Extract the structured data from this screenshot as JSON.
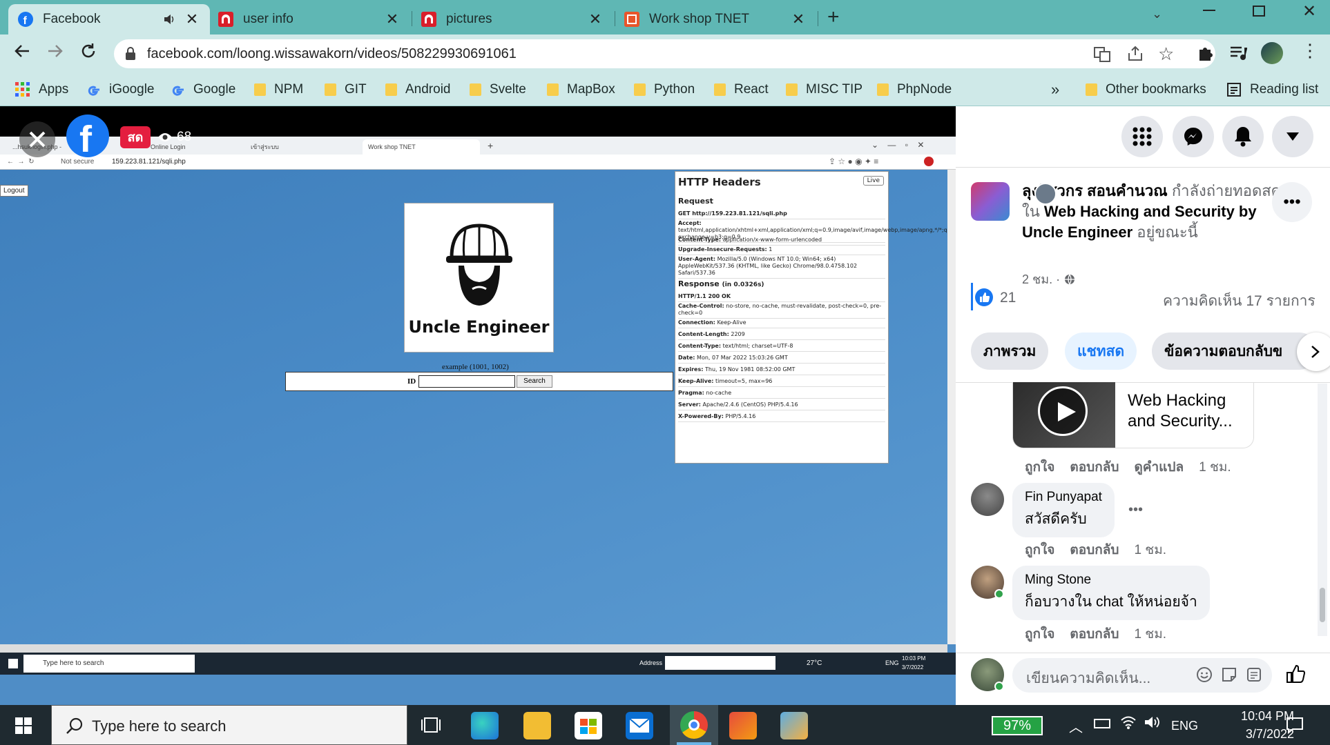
{
  "browser": {
    "tabs": [
      {
        "title": "Facebook",
        "icon": "facebook-icon",
        "active": true
      },
      {
        "title": "user info",
        "icon": "red-app-icon"
      },
      {
        "title": "pictures",
        "icon": "red-app-icon"
      },
      {
        "title": "Work shop TNET",
        "icon": "orange-app-icon"
      }
    ],
    "new_tab_label": "+",
    "url": "facebook.com/loong.wissawakorn/videos/508229930691061",
    "bookmarks": [
      {
        "label": "Apps",
        "icon": "apps-grid-icon"
      },
      {
        "label": "iGoogle",
        "icon": "google-icon"
      },
      {
        "label": "Google",
        "icon": "google-icon"
      },
      {
        "label": "NPM",
        "icon": "folder-icon"
      },
      {
        "label": "GIT",
        "icon": "folder-icon"
      },
      {
        "label": "Android",
        "icon": "folder-icon"
      },
      {
        "label": "Svelte",
        "icon": "folder-icon"
      },
      {
        "label": "MapBox",
        "icon": "folder-icon"
      },
      {
        "label": "Python",
        "icon": "folder-icon"
      },
      {
        "label": "React",
        "icon": "folder-icon"
      },
      {
        "label": "MISC TIP",
        "icon": "folder-icon"
      },
      {
        "label": "PhpNode",
        "icon": "folder-icon"
      }
    ],
    "bookmarks_more": "»",
    "other_bookmarks": "Other bookmarks",
    "reading_list": "Reading list"
  },
  "video": {
    "live_badge": "สด",
    "viewer_count": "68",
    "inner_browser": {
      "tabs": [
        "...hsuk/login.php -",
        "Online Login",
        "เข้าสู่ระบบ",
        "Work shop TNET"
      ],
      "not_secure": "Not secure",
      "url": "159.223.81.121/sqli.php",
      "logout": "Logout",
      "logo_caption": "Uncle Engineer",
      "example": "example (1001, 1002)",
      "id_label": "ID",
      "search_button": "Search",
      "headers_panel": {
        "title": "HTTP Headers",
        "live": "Live",
        "request_label": "Request",
        "request_line": "GET http://159.223.81.121/sqli.php",
        "request_headers": [
          {
            "k": "Accept:",
            "v": "text/html,application/xhtml+xml,application/xml;q=0.9,image/avif,image/webp,image/apng,*/*;q=0.8,application/signed-exchange;v=b3;q=0.9"
          },
          {
            "k": "Content-Type:",
            "v": "application/x-www-form-urlencoded"
          },
          {
            "k": "Upgrade-Insecure-Requests:",
            "v": "1"
          },
          {
            "k": "User-Agent:",
            "v": "Mozilla/5.0 (Windows NT 10.0; Win64; x64) AppleWebKit/537.36 (KHTML, like Gecko) Chrome/98.0.4758.102 Safari/537.36"
          }
        ],
        "response_label": "Response",
        "response_time": "(in 0.0326s)",
        "status_line": "HTTP/1.1 200 OK",
        "response_headers": [
          {
            "k": "Cache-Control:",
            "v": "no-store, no-cache, must-revalidate, post-check=0, pre-check=0"
          },
          {
            "k": "Connection:",
            "v": "Keep-Alive"
          },
          {
            "k": "Content-Length:",
            "v": "2209"
          },
          {
            "k": "Content-Type:",
            "v": "text/html; charset=UTF-8"
          },
          {
            "k": "Date:",
            "v": "Mon, 07 Mar 2022 15:03:26 GMT"
          },
          {
            "k": "Expires:",
            "v": "Thu, 19 Nov 1981 08:52:00 GMT"
          },
          {
            "k": "Keep-Alive:",
            "v": "timeout=5, max=96"
          },
          {
            "k": "Pragma:",
            "v": "no-cache"
          },
          {
            "k": "Server:",
            "v": "Apache/2.4.6 (CentOS) PHP/5.4.16"
          },
          {
            "k": "X-Powered-By:",
            "v": "PHP/5.4.16"
          }
        ]
      },
      "taskbar": {
        "search": "Type here to search",
        "address_label": "Address",
        "temperature": "27°C",
        "lang": "ENG",
        "time": "10:03 PM",
        "date": "3/7/2022"
      }
    }
  },
  "sidebar": {
    "post": {
      "author": "ลุงวิศวกร สอนคำนวณ",
      "verb": " กำลังถ่ายทอดสดใน ",
      "group": "Web Hacking and Security by Uncle Engineer",
      "suffix": " อยู่ขณะนี้",
      "time": "2 ชม. ·",
      "likes": "21",
      "comments_count": "ความคิดเห็น 17 รายการ"
    },
    "tabs": [
      "ภาพรวม",
      "แชทสด",
      "ข้อความตอบกลับข"
    ],
    "shared_card": {
      "title": "Web Hacking and Security..."
    },
    "shared_actions": {
      "like": "ถูกใจ",
      "reply": "ตอบกลับ",
      "translate": "ดูคำแปล",
      "time": "1 ชม."
    },
    "comments": [
      {
        "name": "Fin Punyapat",
        "text": "สวัสดีครับ",
        "like": "ถูกใจ",
        "reply": "ตอบกลับ",
        "time": "1 ชม."
      },
      {
        "name": "Ming Stone",
        "text": "ก็อบวางใน chat ให้หน่อยจ้า",
        "like": "ถูกใจ",
        "reply": "ตอบกลับ",
        "time": "1 ชม."
      }
    ],
    "composer_placeholder": "เขียนความคิดเห็น..."
  },
  "taskbar": {
    "search_placeholder": "Type here to search",
    "battery": "97%",
    "lang": "ENG",
    "time": "10:04 PM",
    "date": "3/7/2022"
  }
}
